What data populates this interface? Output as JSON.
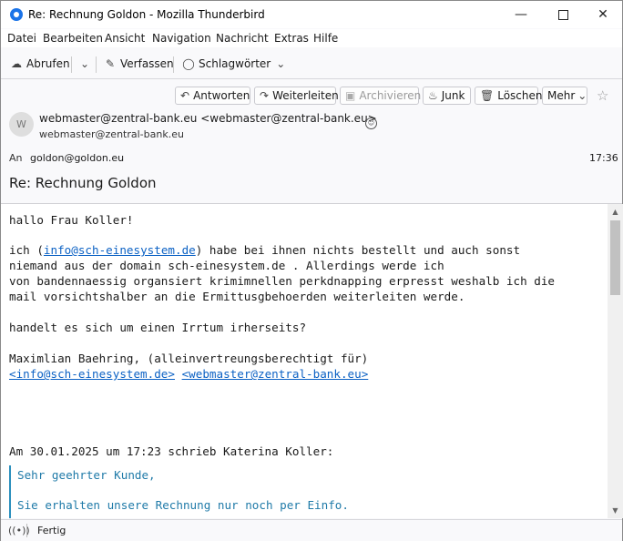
{
  "window": {
    "title": "Re: Rechnung Goldon - Mozilla Thunderbird"
  },
  "menu": [
    "Datei",
    "Bearbeiten",
    "Ansicht",
    "Navigation",
    "Nachricht",
    "Extras",
    "Hilfe"
  ],
  "toolbar": {
    "get_messages": "Abrufen",
    "write": "Verfassen",
    "tags": "Schlagwörter"
  },
  "header_buttons": {
    "reply": "Antworten",
    "forward": "Weiterleiten",
    "archive": "Archivieren",
    "junk": "Junk",
    "delete": "Löschen",
    "more": "Mehr"
  },
  "message": {
    "avatar_letter": "W",
    "from": "webmaster@zentral-bank.eu <webmaster@zentral-bank.eu>",
    "from_sub": "webmaster@zentral-bank.eu",
    "to_label": "An",
    "to": "goldon@goldon.eu",
    "time": "17:36",
    "subject": "Re: Rechnung Goldon"
  },
  "body": {
    "greeting": "hallo Frau Koller!",
    "l1_pre": "ich (",
    "l1_link": "info@sch-einesystem.de",
    "l1_post": ") habe bei ihnen nichts bestellt und auch sonst",
    "l2": "niemand aus der domain sch-einesystem.de . Allerdings werde ich",
    "l3": "von bandennaessig organsiert krimimnellen perkdnapping erpresst weshalb ich die",
    "l4": "mail vorsichtshalber an die Ermittusgbehoerden weiterleiten werde.",
    "question": "handelt es sich um einen Irrtum irherseits?",
    "signature": "Maximlian Baehring, (alleinvertreungsberechtigt für)",
    "sig_link1": "<info@sch-einesystem.de>",
    "sig_link2": "<webmaster@zentral-bank.eu>",
    "quote_intro": "Am 30.01.2025 um 17:23 schrieb Katerina Koller:",
    "quote_l1": "Sehr geehrter Kunde,",
    "quote_l2": "Sie erhalten unsere Rechnung nur noch per Einfo."
  },
  "status": {
    "text": "Fertig"
  }
}
